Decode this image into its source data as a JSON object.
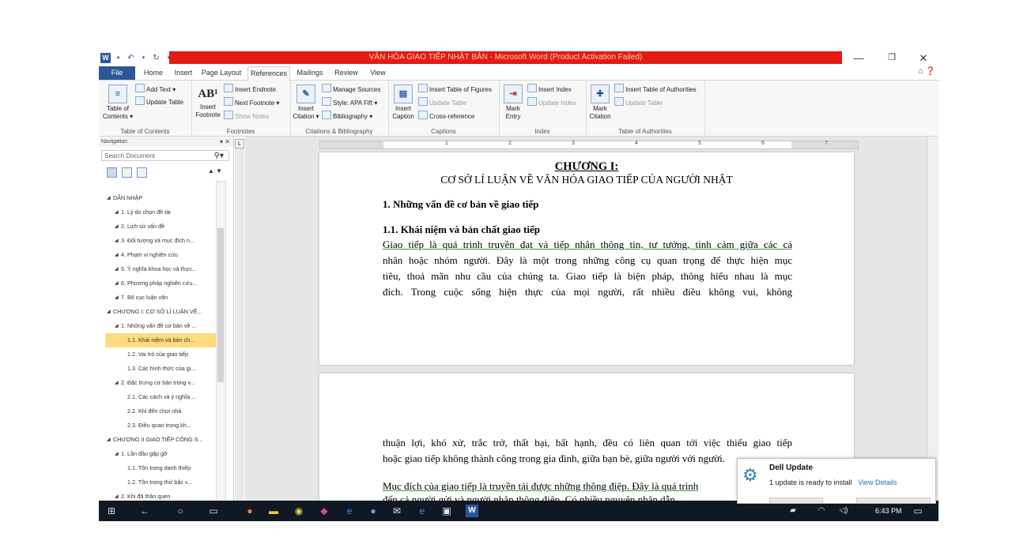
{
  "window": {
    "title": "VĂN HÓA GIAO TIẾP NHẬT BẢN - Microsoft Word (Product Activation Failed)",
    "title_bar_color": "#e51a12",
    "accent_color": "#2b579a",
    "minimize_glyph": "—",
    "restore_glyph": "❐",
    "close_glyph": "✕"
  },
  "tabs": [
    "File",
    "Home",
    "Insert",
    "Page Layout",
    "References",
    "Mailings",
    "Review",
    "View"
  ],
  "active_tab": "References",
  "ribbon": {
    "toc": {
      "label": "Table of Contents",
      "table_of_contents": "Table of",
      "table_of_contents2": "Contents ▾",
      "add_text": "Add Text ▾",
      "update_table": "Update Table"
    },
    "footnotes": {
      "label": "Footnotes",
      "insert_footnote": "Insert",
      "insert_footnote2": "Footnote",
      "icon_text": "AB¹",
      "insert_endnote": "Insert Endnote",
      "next_footnote": "Next Footnote ▾",
      "show_notes": "Show Notes"
    },
    "citations": {
      "label": "Citations & Bibliography",
      "insert_citation": "Insert",
      "insert_citation2": "Citation ▾",
      "manage_sources": "Manage Sources",
      "style": "Style: APA Fift ▾",
      "bibliography": "Bibliography ▾"
    },
    "captions": {
      "label": "Captions",
      "insert_caption": "Insert",
      "insert_caption2": "Caption",
      "insert_table_of_figures": "Insert Table of Figures",
      "update_table": "Update Table",
      "cross_reference": "Cross-reference"
    },
    "index": {
      "label": "Index",
      "mark_entry": "Mark",
      "mark_entry2": "Entry",
      "insert_index": "Insert Index",
      "update_index": "Update Index"
    },
    "authorities": {
      "label": "Table of Authorities",
      "mark_citation": "Mark",
      "mark_citation2": "Citation",
      "insert_table_of_authorities": "Insert Table of Authorities",
      "update_table": "Update Table"
    }
  },
  "navigation": {
    "title": "Navigation",
    "close": "▾ ✕",
    "search_placeholder": "Search Document",
    "items": [
      {
        "text": "DẪN NHẬP",
        "level": 0
      },
      {
        "text": "1. Lý do chọn đề tài",
        "level": 1
      },
      {
        "text": "2. Lịch sử vấn đề",
        "level": 1
      },
      {
        "text": "3. Đối tượng và mục đích n...",
        "level": 1
      },
      {
        "text": "4. Phạm vi nghiên cứu",
        "level": 1
      },
      {
        "text": "5. Ý nghĩa khoa học và thực...",
        "level": 1
      },
      {
        "text": "6. Phương pháp nghiên cứu...",
        "level": 1
      },
      {
        "text": "7. Bố cục luận văn",
        "level": 1
      },
      {
        "text": "CHƯƠNG I: CƠ SỞ LÍ LUẬN VỀ...",
        "level": 0
      },
      {
        "text": "1. Những vấn đề cơ bản về ...",
        "level": 1
      },
      {
        "text": "1.1. Khái niệm và bản ch...",
        "level": 2,
        "selected": true
      },
      {
        "text": "1.2. Vai trò của giao tiếp",
        "level": 2
      },
      {
        "text": "1.3. Các hình thức của gi...",
        "level": 2
      },
      {
        "text": "2. Đặc trưng cơ bản trong v...",
        "level": 1
      },
      {
        "text": "2.1. Các cách và ý nghĩa ...",
        "level": 2
      },
      {
        "text": "2.2. Khi đến chơi nhà",
        "level": 2
      },
      {
        "text": "2.3. Điều quan trọng kh...",
        "level": 2
      },
      {
        "text": "CHƯƠNG II GIAO TIẾP CÔNG S...",
        "level": 0
      },
      {
        "text": "1. Lần đầu gặp gỡ",
        "level": 1
      },
      {
        "text": "1.1. Tôn trọng danh thiếp",
        "level": 2
      },
      {
        "text": "1.2. Tôn trọng thứ bậc v...",
        "level": 2
      },
      {
        "text": "2. Khi đã thân quen",
        "level": 1
      }
    ]
  },
  "ruler": [
    "1",
    "2",
    "3",
    "4",
    "5",
    "6",
    "7"
  ],
  "document": {
    "chapter": "CHƯƠNG I:",
    "chapter_title": "CƠ SỞ LÍ LUẬN VỀ VĂN HÓA GIAO TIẾP CỦA NGƯỜI NHẬT",
    "h1": "1. Những vấn đề cơ bản về giao tiếp",
    "h2": "1.1. Khái niệm và bản chất giao tiếp",
    "p1": [
      "Giao tiếp là quá trình truyền đạt và tiếp nhận thông tin, tư tưởng, tình cảm giữa các cá",
      "nhân hoặc nhóm người. Đây là một trong những công cụ quan trọng để thực hiện mục",
      "tiêu, thoả mãn nhu cầu của chúng ta. Giao tiếp là biện pháp, thông hiểu nhau là mục",
      "đích. Trong cuộc sống hiện thực của mọi người, rất nhiều điều không vui, không"
    ],
    "p2": [
      "thuận lợi, khó xử, trắc trở, thất bại, bất hạnh, đều có liên quan tới việc thiếu giao tiếp",
      "hoặc giao tiếp không thành công trong gia đình, giữa bạn bè, giữa người với người."
    ],
    "p3": [
      "Mục đích của giao tiếp là truyền tải được những thông điệp. Đây là quá trình",
      "đến cả người gửi và người nhận thông điệp. Có nhiều nguyên nhân dẫn"
    ]
  },
  "taskbar": {
    "time": "6:43 PM",
    "icons": [
      "windows-icon",
      "back-icon",
      "search-icon",
      "task-view-icon",
      "firefox-icon",
      "file-explorer-icon",
      "chrome-icon",
      "maps-icon",
      "ie-icon",
      "app-icon",
      "mail-icon",
      "edge-icon",
      "store-icon",
      "word-icon"
    ]
  },
  "notification": {
    "title": "Dell Update",
    "message": "1 update is ready to install",
    "link": "View Details"
  }
}
